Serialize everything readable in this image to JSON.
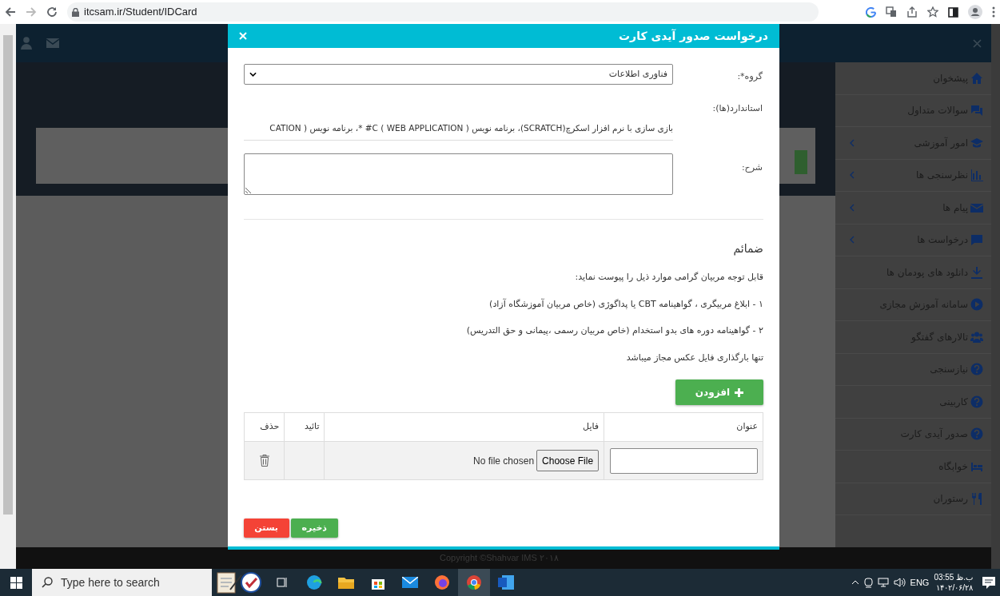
{
  "browser": {
    "url": "itcsam.ir/Student/IDCard"
  },
  "sidebar": {
    "items": [
      {
        "label": "پیشخوان",
        "submenu": false
      },
      {
        "label": "سوالات متداول",
        "submenu": false
      },
      {
        "label": "امور آموزشی",
        "submenu": true
      },
      {
        "label": "نظرسنجی ها",
        "submenu": true
      },
      {
        "label": "پیام ها",
        "submenu": true
      },
      {
        "label": "درخواست ها",
        "submenu": true
      },
      {
        "label": "دانلود های پودمان ها",
        "submenu": false
      },
      {
        "label": "سامانه آموزش مجازی",
        "submenu": false
      },
      {
        "label": "تالارهای گفتگو",
        "submenu": false
      },
      {
        "label": "نیازسنجی",
        "submenu": false
      },
      {
        "label": "کاربینی",
        "submenu": false
      },
      {
        "label": "صدور آیدی کارت",
        "submenu": false
      },
      {
        "label": "خوابگاه",
        "submenu": false
      },
      {
        "label": "رستوران",
        "submenu": false
      }
    ]
  },
  "footer": {
    "copyright": "Copyright ©Shahvar IMS ۲۰۱۸"
  },
  "modal": {
    "title": "درخواست صدور آیدی کارت",
    "fields": [
      {
        "kind": "select",
        "label": "گروه*:",
        "value": "فناوری اطلاعات"
      },
      {
        "kind": "text",
        "label": "استاندارد(ها):",
        "value": "بازی سازی با نرم افزار اسکرچ(SCRATCH)، برنامه نویس ( WEB APPLICATION ) C# *، برنامه نویس ( CATION"
      },
      {
        "kind": "textarea",
        "label": "شرح:"
      }
    ],
    "attachments": {
      "heading": "ضمائم",
      "notes": [
        "قابل توجه مربیان گرامی موارد ذیل را پیوست نماید:",
        "۱ - ابلاغ مربیگری ، گواهینامه CBT یا پداگوژی (خاص مربیان آموزشگاه آزاد)",
        "۲ - گواهینامه دوره های بدو استخدام (خاص مربیان رسمی ،پیمانی و حق التدریس)",
        "تنها بارگذاری فایل عکس مجاز میباشد"
      ],
      "add_button": "افزودن"
    },
    "table": {
      "columns": [
        "عنوان",
        "فایل",
        "تائید",
        "حذف"
      ],
      "rows": [
        {
          "file_button": "Choose File",
          "file_status": "No file chosen"
        }
      ]
    },
    "buttons": [
      {
        "label": "ذخیره",
        "kind": "success"
      },
      {
        "label": "بستن",
        "kind": "danger"
      }
    ]
  },
  "taskbar": {
    "search": {
      "placeholder": "Type here to search"
    },
    "language": "ENG",
    "time": "03:55 ب.ظ",
    "date": "۱۴۰۲/۰۶/۲۸"
  }
}
